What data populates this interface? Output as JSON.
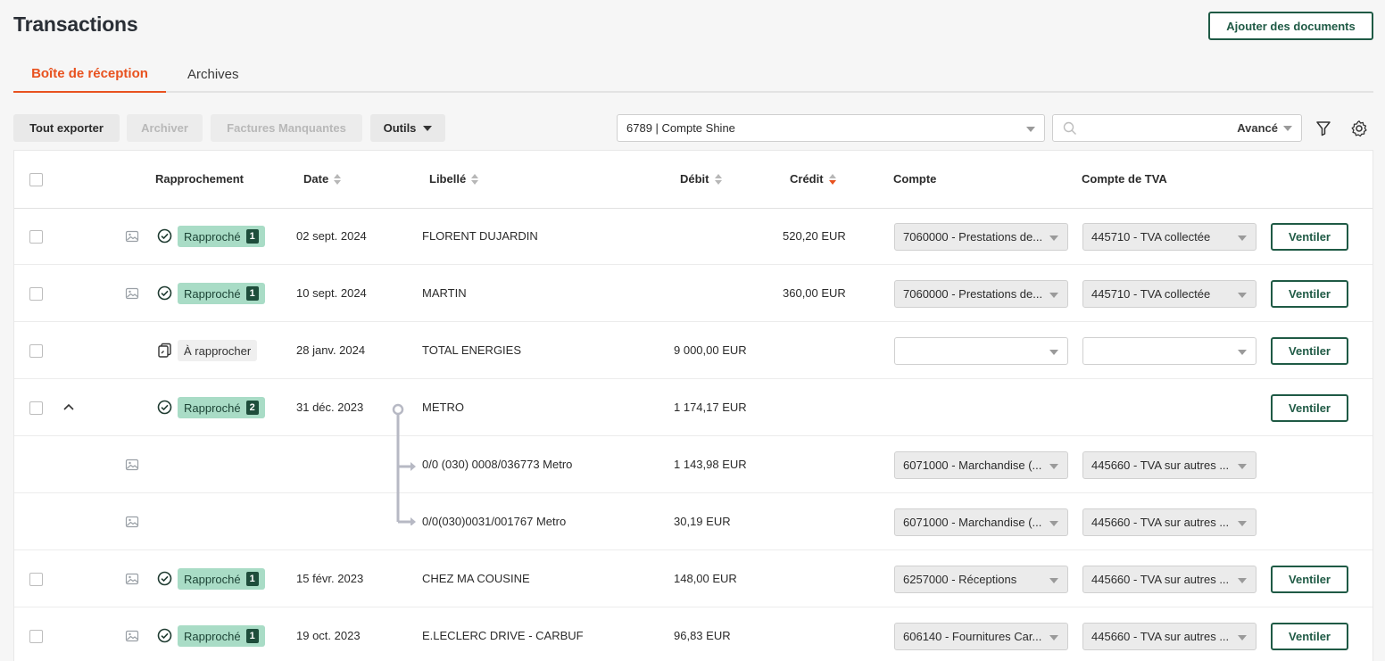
{
  "header": {
    "title": "Transactions",
    "add_docs_label": "Ajouter des documents"
  },
  "tabs": [
    {
      "label": "Boîte de réception",
      "active": true
    },
    {
      "label": "Archives",
      "active": false
    }
  ],
  "toolbar": {
    "export_label": "Tout exporter",
    "archive_label": "Archiver",
    "missing_label": "Factures Manquantes",
    "tools_label": "Outils",
    "account_value": "6789 | Compte Shine",
    "search_value": "",
    "advanced_label": "Avancé"
  },
  "table": {
    "headers": {
      "reconciliation": "Rapprochement",
      "date": "Date",
      "label": "Libellé",
      "debit": "Débit",
      "credit": "Crédit",
      "account": "Compte",
      "vat_account": "Compte de TVA"
    },
    "ventiler_label": "Ventiler",
    "rows": [
      {
        "status": "Rapproché",
        "count": "1",
        "date": "02 sept. 2024",
        "label": "FLORENT DUJARDIN",
        "debit": "",
        "credit": "520,20 EUR",
        "account": "7060000 - Prestations de...",
        "vat": "445710 - TVA collectée"
      },
      {
        "status": "Rapproché",
        "count": "1",
        "date": "10 sept. 2024",
        "label": "MARTIN",
        "debit": "",
        "credit": "360,00 EUR",
        "account": "7060000 - Prestations de...",
        "vat": "445710 - TVA collectée"
      },
      {
        "status": "À rapprocher",
        "count": "",
        "date": "28 janv. 2024",
        "label": "TOTAL ENERGIES",
        "debit": "9 000,00 EUR",
        "credit": "",
        "account": "",
        "vat": ""
      },
      {
        "status": "Rapproché",
        "count": "2",
        "date": "31 déc. 2023",
        "label": "METRO",
        "debit": "1 174,17 EUR",
        "credit": "",
        "account": "",
        "vat": ""
      },
      {
        "sub": true,
        "label": "0/0 (030) 0008/036773 Metro",
        "debit": "1 143,98 EUR",
        "account": "6071000 - Marchandise (...",
        "vat": "445660 - TVA sur autres ..."
      },
      {
        "sub": true,
        "label": "0/0(030)0031/001767 Metro",
        "debit": "30,19 EUR",
        "account": "6071000 - Marchandise (...",
        "vat": "445660 - TVA sur autres ..."
      },
      {
        "status": "Rapproché",
        "count": "1",
        "date": "15 févr. 2023",
        "label": "CHEZ MA COUSINE",
        "debit": "148,00 EUR",
        "credit": "",
        "account": "6257000 - Réceptions",
        "vat": "445660 - TVA sur autres ..."
      },
      {
        "status": "Rapproché",
        "count": "1",
        "date": "19 oct. 2023",
        "label": "E.LECLERC DRIVE - CARBUF",
        "debit": "96,83 EUR",
        "credit": "",
        "account": "606140 - Fournitures Car...",
        "vat": "445660 - TVA sur autres ..."
      }
    ]
  },
  "colors": {
    "accent": "#e8521f",
    "brand_green": "#1f5a45",
    "badge_green": "#a9dcc6"
  }
}
